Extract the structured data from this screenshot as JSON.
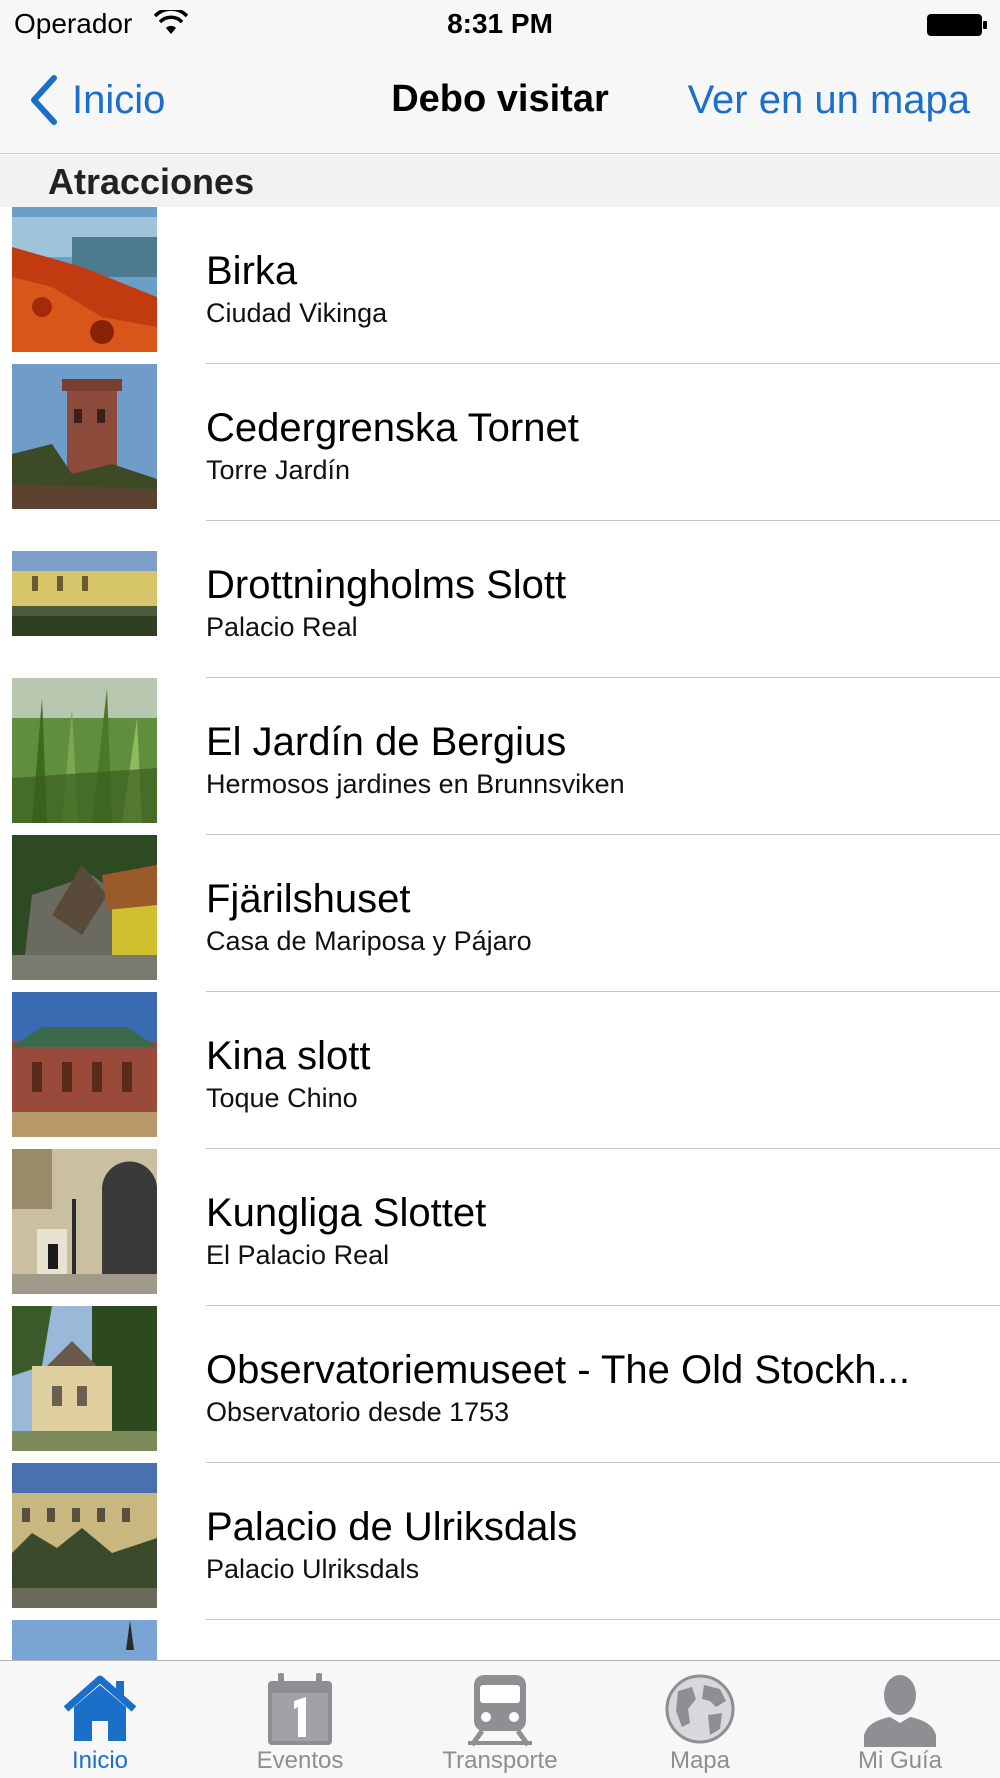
{
  "status_bar": {
    "carrier": "Operador",
    "time": "8:31 PM"
  },
  "nav": {
    "back_label": "Inicio",
    "title": "Debo visitar",
    "right_label": "Ver en un mapa"
  },
  "section": {
    "title": "Atracciones"
  },
  "items": [
    {
      "title": "Birka",
      "subtitle": "Ciudad Vikinga"
    },
    {
      "title": "Cedergrenska Tornet",
      "subtitle": "Torre Jardín"
    },
    {
      "title": "Drottningholms Slott",
      "subtitle": "Palacio Real"
    },
    {
      "title": "El Jardín de Bergius",
      "subtitle": "Hermosos jardines en Brunnsviken"
    },
    {
      "title": "Fjärilshuset",
      "subtitle": "Casa de Mariposa y Pájaro"
    },
    {
      "title": "Kina slott",
      "subtitle": "Toque Chino"
    },
    {
      "title": "Kungliga Slottet",
      "subtitle": "El Palacio Real"
    },
    {
      "title": "Observatoriemuseet - The Old Stockh...",
      "subtitle": "Observatorio desde 1753"
    },
    {
      "title": "Palacio de Ulriksdals",
      "subtitle": "Palacio Ulriksdals"
    }
  ],
  "tabs": [
    {
      "label": "Inicio",
      "icon": "home-icon",
      "active": true
    },
    {
      "label": "Eventos",
      "icon": "calendar-icon",
      "active": false
    },
    {
      "label": "Transporte",
      "icon": "train-icon",
      "active": false
    },
    {
      "label": "Mapa",
      "icon": "globe-icon",
      "active": false
    },
    {
      "label": "Mi Guía",
      "icon": "person-icon",
      "active": false
    }
  ],
  "colors": {
    "accent": "#1a6fc9",
    "tab_inactive": "#8e8e93",
    "separator": "#c8c7cc"
  }
}
